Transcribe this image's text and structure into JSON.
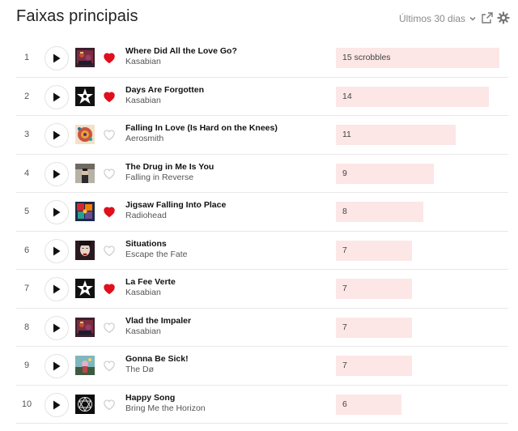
{
  "header": {
    "title": "Faixas principais",
    "period_label": "Últimos 30 dias",
    "chevron_icon": "chevron-down-icon",
    "share_icon": "share-icon",
    "settings_icon": "gear-icon"
  },
  "colors": {
    "loved_heart": "#e00f1c",
    "bar_fill": "#fce6e6",
    "divider": "#e8e8e8"
  },
  "tracks": [
    {
      "rank": "1",
      "title": "Where Did All the Love Go?",
      "artist": "Kasabian",
      "loved": true,
      "scrobbles": 15,
      "scrobble_label": "15 scrobbles",
      "art": "kasabian-velociraptor"
    },
    {
      "rank": "2",
      "title": "Days Are Forgotten",
      "artist": "Kasabian",
      "loved": true,
      "scrobbles": 14,
      "scrobble_label": "14",
      "art": "kasabian-star"
    },
    {
      "rank": "3",
      "title": "Falling In Love (Is Hard on the Knees)",
      "artist": "Aerosmith",
      "loved": false,
      "scrobbles": 11,
      "scrobble_label": "11",
      "art": "aerosmith"
    },
    {
      "rank": "4",
      "title": "The Drug in Me Is You",
      "artist": "Falling in Reverse",
      "loved": false,
      "scrobbles": 9,
      "scrobble_label": "9",
      "art": "falling-in-reverse"
    },
    {
      "rank": "5",
      "title": "Jigsaw Falling Into Place",
      "artist": "Radiohead",
      "loved": true,
      "scrobbles": 8,
      "scrobble_label": "8",
      "art": "radiohead"
    },
    {
      "rank": "6",
      "title": "Situations",
      "artist": "Escape the Fate",
      "loved": false,
      "scrobbles": 7,
      "scrobble_label": "7",
      "art": "escape-the-fate"
    },
    {
      "rank": "7",
      "title": "La Fee Verte",
      "artist": "Kasabian",
      "loved": true,
      "scrobbles": 7,
      "scrobble_label": "7",
      "art": "kasabian-star"
    },
    {
      "rank": "8",
      "title": "Vlad the Impaler",
      "artist": "Kasabian",
      "loved": false,
      "scrobbles": 7,
      "scrobble_label": "7",
      "art": "kasabian-velociraptor"
    },
    {
      "rank": "9",
      "title": "Gonna Be Sick!",
      "artist": "The Dø",
      "loved": false,
      "scrobbles": 7,
      "scrobble_label": "7",
      "art": "the-do"
    },
    {
      "rank": "10",
      "title": "Happy Song",
      "artist": "Bring Me the Horizon",
      "loved": false,
      "scrobbles": 6,
      "scrobble_label": "6",
      "art": "bmth"
    }
  ]
}
